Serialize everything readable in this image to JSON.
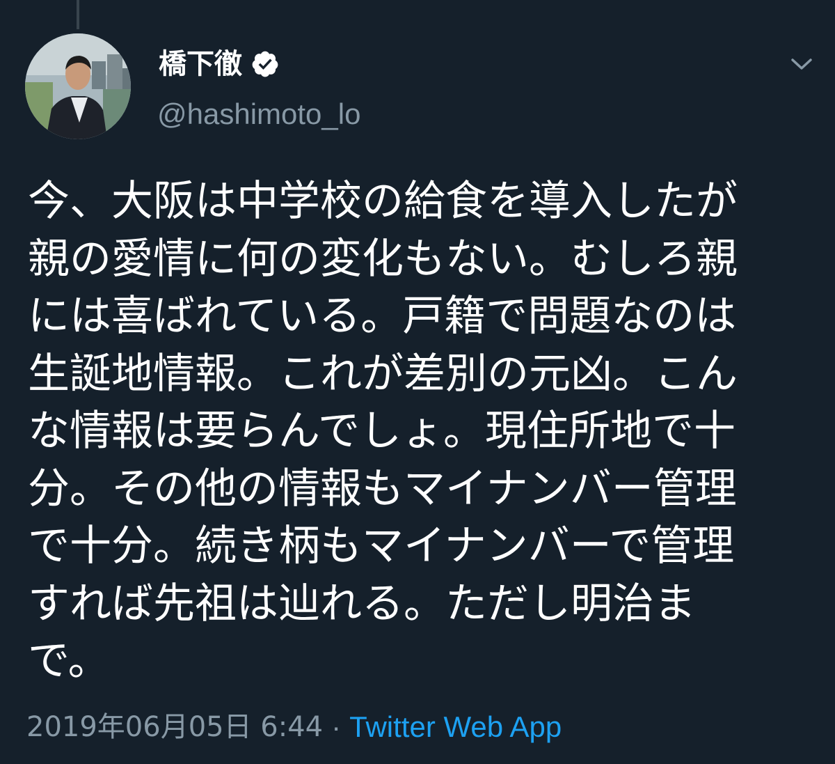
{
  "tweet": {
    "author": {
      "display_name": "橋下徹",
      "handle": "@hashimoto_lo",
      "verified": true
    },
    "text_lines": [
      "今、大阪は中学校の給食を導入したが",
      "親の愛情に何の変化もない。むしろ親",
      "には喜ばれている。戸籍で問題なのは",
      "生誕地情報。これが差別の元凶。こん",
      "な情報は要らんでしょ。現住所地で十",
      "分。その他の情報もマイナンバー管理",
      "で十分。続き柄もマイナンバーで管理",
      "すれば先祖は辿れる。ただし明治ま",
      "で。"
    ],
    "timestamp": "2019年06月05日 6:44",
    "separator": "·",
    "source": "Twitter Web App"
  },
  "icons": {
    "verified": "verified-badge-icon",
    "caret": "chevron-down-icon"
  },
  "colors": {
    "background": "#15202b",
    "text": "#ffffff",
    "secondary_text": "#8899a6",
    "link": "#1da1f2"
  }
}
